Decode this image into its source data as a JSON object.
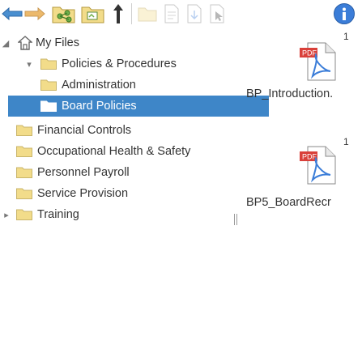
{
  "toolbar": {
    "buttons": [
      {
        "icon": "back-arrow-icon"
      },
      {
        "icon": "forward-arrow-icon"
      },
      {
        "icon": "folder-network-icon"
      },
      {
        "icon": "folder-browse-icon"
      },
      {
        "icon": "upload-arrow-icon"
      },
      {
        "icon": "folder-new-icon"
      },
      {
        "icon": "document-properties-icon"
      },
      {
        "icon": "document-arrow-icon"
      },
      {
        "icon": "document-cursor-icon"
      },
      {
        "icon": "info-icon"
      }
    ]
  },
  "tree": {
    "root": {
      "label": "My Files",
      "icon": "home-icon"
    },
    "policies": {
      "label": "Policies & Procedures"
    },
    "children": [
      {
        "label": "Administration"
      },
      {
        "label": "Board Policies",
        "selected": true
      },
      {
        "label": "Financial Controls"
      },
      {
        "label": "Occupational Health & Safety"
      },
      {
        "label": "Personnel Payroll"
      },
      {
        "label": "Service Provision"
      }
    ],
    "training": {
      "label": "Training"
    }
  },
  "files": [
    {
      "count": "1",
      "name": "BP_Introduction.",
      "icon": "pdf-file-icon"
    },
    {
      "count": "1",
      "name": "BP5_BoardRecr",
      "icon": "pdf-file-icon"
    }
  ],
  "colors": {
    "selection": "#3e86c8",
    "folder": "#f2dc8a",
    "accent_blue": "#3b7dd8",
    "pdf_red": "#d9403a"
  }
}
